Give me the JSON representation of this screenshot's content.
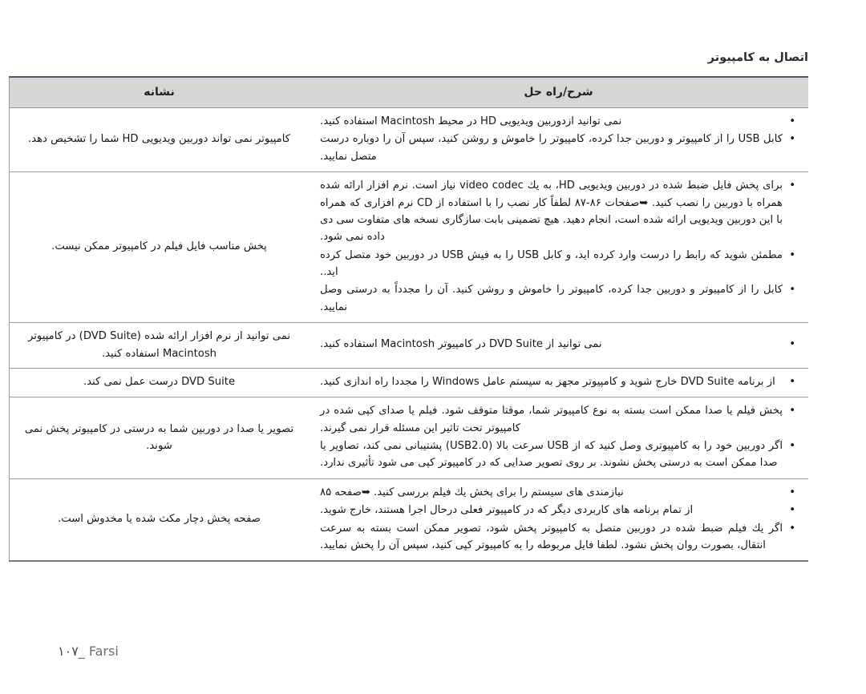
{
  "document": {
    "section_title": "اتصال به کامپیوتر",
    "footer": {
      "page_number": "۱۰۷",
      "separator": "_",
      "language": "Farsi"
    }
  },
  "table": {
    "headers": {
      "symptom": "نشانه",
      "solution": "شرح/راه حل"
    },
    "rows": [
      {
        "symptom": "کامپیوتر نمی تواند دوربین ویدیویی HD شما را تشخیص دهد.",
        "solutions": [
          "نمی توانید ازدوربین ویدیویی HD در محیط Macintosh استفاده کنید.",
          "کابل USB را از کامپیوتر و دوربین جدا کرده، کامپیوتر را خاموش و روشن کنید، سپس آن را دوباره درست متصل نمایید."
        ]
      },
      {
        "symptom": "پخش مناسب فایل فیلم در کامپیوتر ممکن نیست.",
        "solutions": [
          "برای پخش فایل ضبط شده در دوربین ویدیویی HD، به یك video codec نیاز است. نرم افزار ارائه شده همراه با دوربین را نصب کنید. ➥صفحات ۸۶-۸۷ لطفاً کار نصب را با استفاده از CD نرم افزاری که همراه با این دوربین ویدیویی ارائه شده است، انجام دهید. هیچ تضمینی بابت سازگاری نسخه های متفاوت سی دی داده نمی شود.",
          "مطمئن شوید که رابط را درست وارد کرده اید، و کابل USB را به فیش USB در دوربین خود متصل کرده اید..",
          "کابل را از کامپیوتر و دوربین جدا کرده، کامپیوتر را خاموش و روشن کنید. آن را مجدداً به درستی وصل نمایید."
        ]
      },
      {
        "symptom": "نمی توانید از نرم افزار ارائه شده (DVD Suite) در کامپیوتر Macintosh استفاده کنید.",
        "solutions": [
          "نمی توانید از DVD Suite در کامپیوتر Macintosh استفاده کنید."
        ]
      },
      {
        "symptom": "DVD Suite درست عمل نمی کند.",
        "solutions": [
          "از برنامه DVD Suite خارج شوید و کامپیوتر مجهز به سیستم عامل Windows را مجددا راه اندازی کنید."
        ]
      },
      {
        "symptom": "تصویر یا صدا در دوربین شما به درستی در کامپیوتر پخش نمی شوند.",
        "solutions": [
          "پخش فیلم یا صدا ممکن است بسته به نوع کامپیوتر شما، موقتا متوقف شود. فیلم یا صدای کپی شده در کامپیوتر تحت تاثیر این مسئله قرار نمی گیرند.",
          "اگر دوربین خود را به کامپیوتری وصل کنید که از USB سرعت بالا (USB2.0) پشتیبانی نمی کند، تصاویر یا صدا ممکن است به درستی پخش نشوند. بر روی تصویر صدایی که در کامپیوتر کپی می شود تأثیری ندارد."
        ]
      },
      {
        "symptom": "صفحه پخش دچار مکث شده یا مخدوش است.",
        "solutions": [
          "نیازمندی های سیستم را برای پخش یك فیلم بررسی کنید. ➥صفحه ۸۵",
          "از تمام برنامه های کاربردی دیگر که در کامپیوتر فعلی درحال اجرا هستند، خارج شوید.",
          "اگر یك فیلم ضبط شده در دوربین متصل به کامپیوتر پخش شود، تصویر ممکن است بسته به سرعت انتقال، بصورت روان پخش نشود. لطفا فایل مربوطه را به کامپیوتر کپی کنید، سپس آن را پخش نمایید."
        ]
      }
    ]
  }
}
